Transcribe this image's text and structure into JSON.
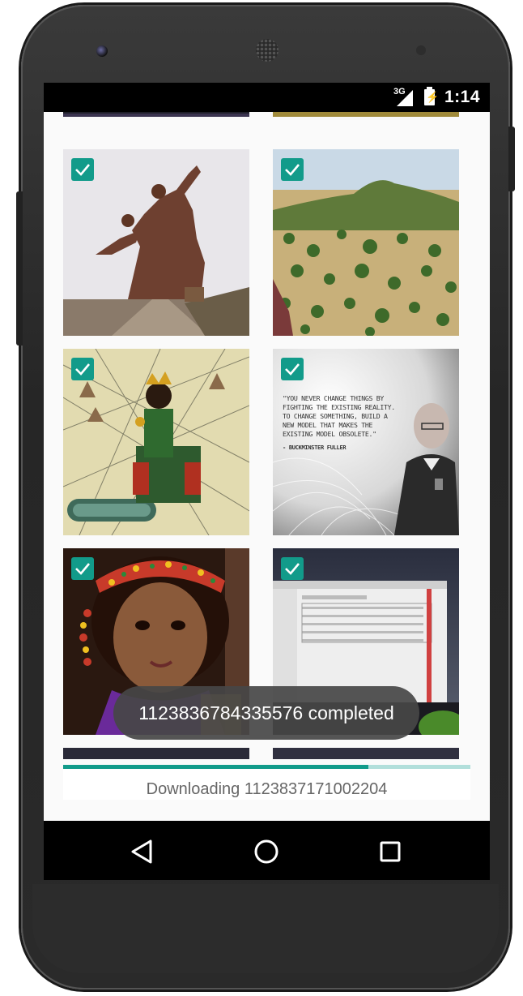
{
  "status_bar": {
    "network": "3G",
    "time": "1:14"
  },
  "gallery": {
    "tiles": [
      {
        "name": "monument",
        "selected": true
      },
      {
        "name": "landscape-hill",
        "selected": true
      },
      {
        "name": "map-king",
        "selected": true
      },
      {
        "name": "quote-image",
        "selected": true
      },
      {
        "name": "portrait-girl",
        "selected": true
      },
      {
        "name": "screenshot-night",
        "selected": true
      }
    ],
    "quote_text": [
      "\"YOU NEVER CHANGE THINGS BY",
      "FIGHTING THE EXISTING REALITY.",
      "TO CHANGE SOMETHING, BUILD A",
      "NEW MODEL THAT MAKES THE",
      "EXISTING MODEL OBSOLETE.\""
    ],
    "quote_author": "- BUCKMINSTER FULLER"
  },
  "toast": {
    "message": "1123836784335576 completed"
  },
  "download": {
    "label": "Downloading 1123837171002204",
    "progress": 0.75
  },
  "colors": {
    "accent": "#129b8a",
    "accent_light": "#b2dfdb",
    "toast_bg": "#464646"
  },
  "nav": {
    "back": "back-icon",
    "home": "home-icon",
    "recents": "recents-icon"
  }
}
